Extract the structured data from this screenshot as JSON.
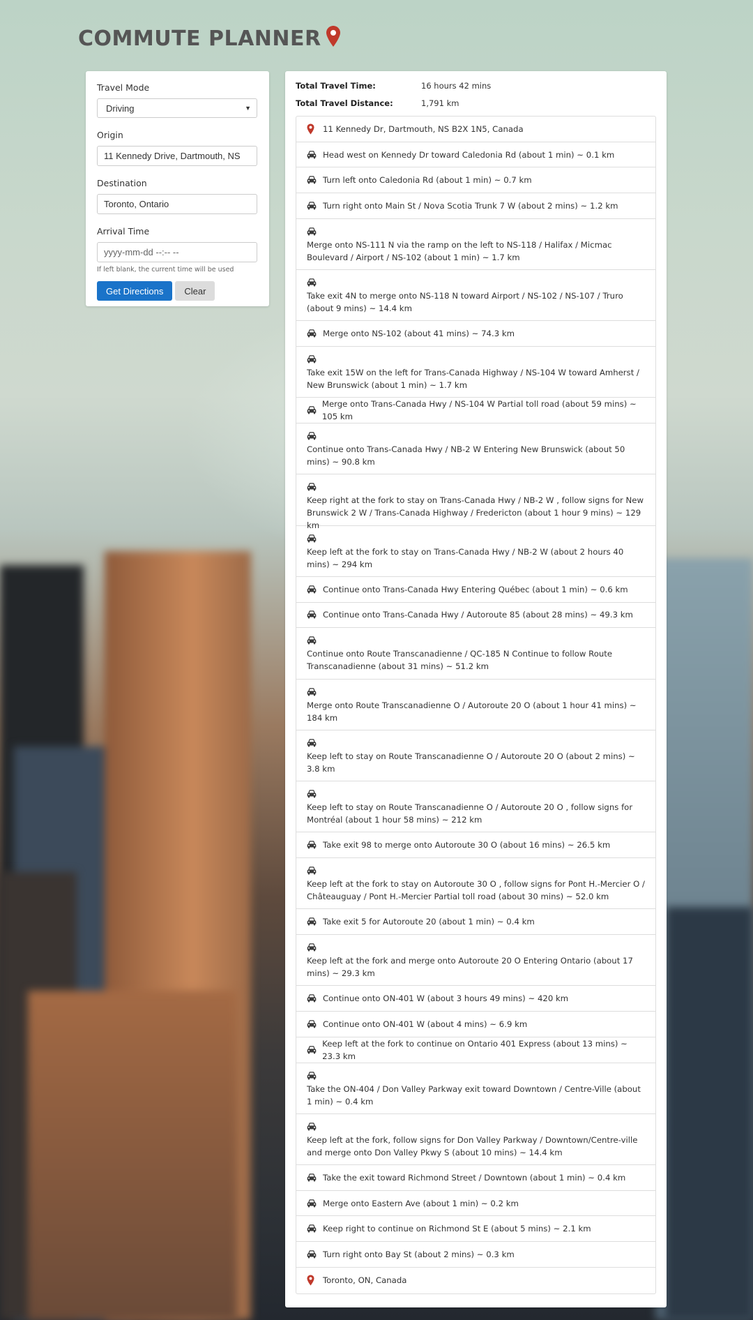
{
  "app": {
    "title": "COMMUTE PLANNER",
    "title_icon": "map-marker-icon"
  },
  "form": {
    "travel_mode": {
      "label": "Travel Mode",
      "value": "Driving"
    },
    "origin": {
      "label": "Origin",
      "value": "11 Kennedy Drive, Dartmouth, NS"
    },
    "destination": {
      "label": "Destination",
      "value": "Toronto, Ontario"
    },
    "arrival_time": {
      "label": "Arrival Time",
      "placeholder": "yyyy-mm-dd --:-- --",
      "help": "If left blank, the current time will be used"
    },
    "get_directions_label": "Get Directions",
    "clear_label": "Clear"
  },
  "summary": {
    "time_label": "Total Travel Time:",
    "time_value": "16 hours 42 mins",
    "distance_label": "Total Travel Distance:",
    "distance_value": "1,791 km"
  },
  "colors": {
    "accent": "#1a73c9",
    "marker": "#c0392b"
  },
  "steps": [
    {
      "icon": "map-marker-icon",
      "text": "11 Kennedy Dr, Dartmouth, NS B2X 1N5, Canada",
      "layout": "single"
    },
    {
      "icon": "car-icon",
      "text": "Head west on Kennedy Dr toward Caledonia Rd (about 1 min) ~ 0.1 km",
      "layout": "single"
    },
    {
      "icon": "car-icon",
      "text": "Turn left onto Caledonia Rd (about 1 min) ~ 0.7 km",
      "layout": "single"
    },
    {
      "icon": "car-icon",
      "text": "Turn right onto Main St / Nova Scotia Trunk 7 W (about 2 mins) ~ 1.2 km",
      "layout": "single"
    },
    {
      "icon": "car-icon",
      "text": "Merge onto NS-111 N via the ramp on the left to NS-118 / Halifax / Micmac Boulevard / Airport / NS-102 (about 1 min) ~ 1.7 km",
      "layout": "multi"
    },
    {
      "icon": "car-icon",
      "text": "Take exit 4N to merge onto NS-118 N toward Airport / NS-102 / NS-107 / Truro (about 9 mins) ~ 14.4 km",
      "layout": "multi"
    },
    {
      "icon": "car-icon",
      "text": "Merge onto NS-102 (about 41 mins) ~ 74.3 km",
      "layout": "single"
    },
    {
      "icon": "car-icon",
      "text": "Take exit 15W on the left for Trans-Canada Highway / NS-104 W toward Amherst / New Brunswick (about 1 min) ~ 1.7 km",
      "layout": "multi"
    },
    {
      "icon": "car-icon",
      "text": "Merge onto Trans-Canada Hwy / NS-104 W Partial toll road (about 59 mins) ~ 105 km",
      "layout": "single"
    },
    {
      "icon": "car-icon",
      "text": "Continue onto Trans-Canada Hwy / NB-2 W Entering New Brunswick (about 50 mins) ~ 90.8 km",
      "layout": "multi"
    },
    {
      "icon": "car-icon",
      "text": "Keep right at the fork to stay on Trans-Canada Hwy / NB-2 W , follow signs for New Brunswick 2 W / Trans-Canada Highway / Fredericton (about 1 hour 9 mins) ~ 129 km",
      "layout": "multi"
    },
    {
      "icon": "car-icon",
      "text": "Keep left at the fork to stay on Trans-Canada Hwy / NB-2 W (about 2 hours 40 mins) ~ 294 km",
      "layout": "multi"
    },
    {
      "icon": "car-icon",
      "text": "Continue onto Trans-Canada Hwy Entering Québec (about 1 min) ~ 0.6 km",
      "layout": "single"
    },
    {
      "icon": "car-icon",
      "text": "Continue onto Trans-Canada Hwy / Autoroute 85 (about 28 mins) ~ 49.3 km",
      "layout": "single"
    },
    {
      "icon": "car-icon",
      "text": "Continue onto Route Transcanadienne / QC-185 N Continue to follow Route Transcanadienne (about 31 mins) ~ 51.2 km",
      "layout": "multi"
    },
    {
      "icon": "car-icon",
      "text": "Merge onto Route Transcanadienne O / Autoroute 20 O (about 1 hour 41 mins) ~ 184 km",
      "layout": "multi"
    },
    {
      "icon": "car-icon",
      "text": "Keep left to stay on Route Transcanadienne O / Autoroute 20 O (about 2 mins) ~ 3.8 km",
      "layout": "multi"
    },
    {
      "icon": "car-icon",
      "text": "Keep left to stay on Route Transcanadienne O / Autoroute 20 O , follow signs for Montréal (about 1 hour 58 mins) ~ 212 km",
      "layout": "multi"
    },
    {
      "icon": "car-icon",
      "text": "Take exit 98 to merge onto Autoroute 30 O (about 16 mins) ~ 26.5 km",
      "layout": "single"
    },
    {
      "icon": "car-icon",
      "text": "Keep left at the fork to stay on Autoroute 30 O , follow signs for Pont H.-Mercier O / Châteauguay / Pont H.-Mercier Partial toll road (about 30 mins) ~ 52.0 km",
      "layout": "multi"
    },
    {
      "icon": "car-icon",
      "text": "Take exit 5 for Autoroute 20 (about 1 min) ~ 0.4 km",
      "layout": "single"
    },
    {
      "icon": "car-icon",
      "text": "Keep left at the fork and merge onto Autoroute 20 O Entering Ontario (about 17 mins) ~ 29.3 km",
      "layout": "multi"
    },
    {
      "icon": "car-icon",
      "text": "Continue onto ON-401 W (about 3 hours 49 mins) ~ 420 km",
      "layout": "single"
    },
    {
      "icon": "car-icon",
      "text": "Continue onto ON-401 W (about 4 mins) ~ 6.9 km",
      "layout": "single"
    },
    {
      "icon": "car-icon",
      "text": "Keep left at the fork to continue on Ontario 401 Express (about 13 mins) ~ 23.3 km",
      "layout": "single"
    },
    {
      "icon": "car-icon",
      "text": "Take the ON-404 / Don Valley Parkway exit toward Downtown / Centre-Ville (about 1 min) ~ 0.4 km",
      "layout": "multi"
    },
    {
      "icon": "car-icon",
      "text": "Keep left at the fork, follow signs for Don Valley Parkway / Downtown/Centre-ville and merge onto Don Valley Pkwy S (about 10 mins) ~ 14.4 km",
      "layout": "multi"
    },
    {
      "icon": "car-icon",
      "text": "Take the exit toward Richmond Street / Downtown (about 1 min) ~ 0.4 km",
      "layout": "single"
    },
    {
      "icon": "car-icon",
      "text": "Merge onto Eastern Ave (about 1 min) ~ 0.2 km",
      "layout": "single"
    },
    {
      "icon": "car-icon",
      "text": "Keep right to continue on Richmond St E (about 5 mins) ~ 2.1 km",
      "layout": "single"
    },
    {
      "icon": "car-icon",
      "text": "Turn right onto Bay St (about 2 mins) ~ 0.3 km",
      "layout": "single"
    },
    {
      "icon": "map-marker-icon",
      "text": "Toronto, ON, Canada",
      "layout": "single"
    }
  ]
}
